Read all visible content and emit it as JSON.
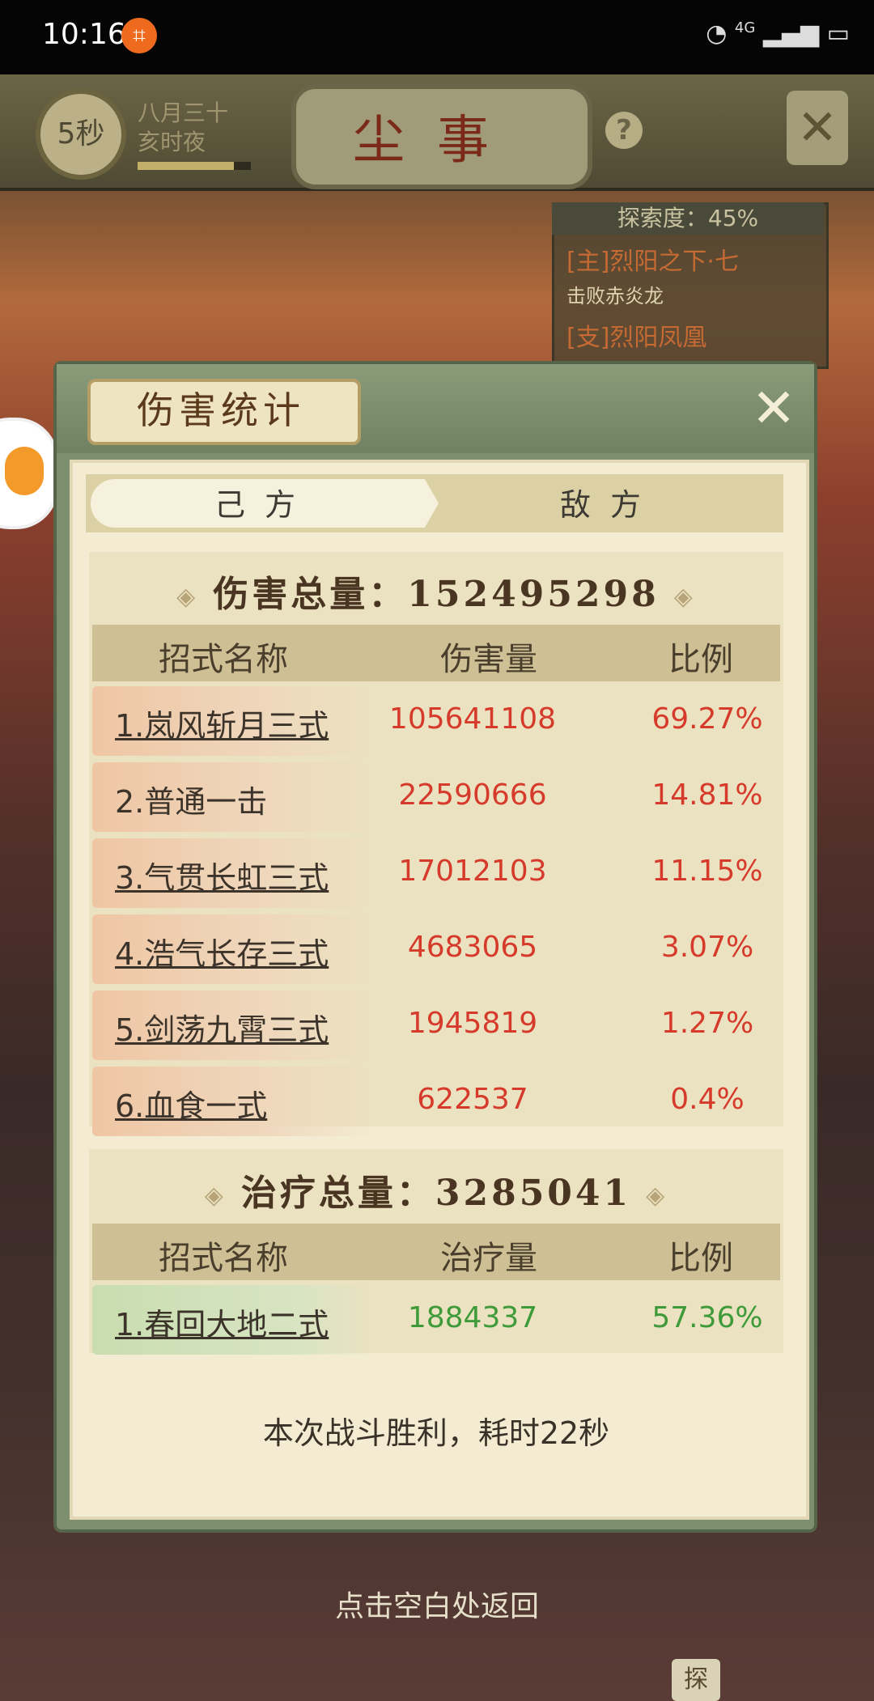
{
  "status_bar": {
    "time": "10:16",
    "network": "4G"
  },
  "game": {
    "timer": "5秒",
    "date_line1": "八月三十",
    "date_line2": "亥时夜",
    "title": "尘事",
    "help": "?",
    "quest": {
      "progress": "探索度：45%",
      "main": "[主]烈阳之下·七",
      "main_sub": "击败赤炎龙",
      "side": "[支]烈阳凤凰"
    }
  },
  "dialog": {
    "title": "伤害统计",
    "tabs": {
      "own": "己方",
      "enemy": "敌方"
    },
    "damage": {
      "total_label": "伤害总量：152495298",
      "headers": {
        "name": "招式名称",
        "value": "伤害量",
        "ratio": "比例"
      },
      "rows": [
        {
          "name": "1.岚风斩月三式",
          "value": "105641108",
          "ratio": "69.27%"
        },
        {
          "name": "2.普通一击",
          "value": "22590666",
          "ratio": "14.81%"
        },
        {
          "name": "3.气贯长虹三式",
          "value": "17012103",
          "ratio": "11.15%"
        },
        {
          "name": "4.浩气长存三式",
          "value": "4683065",
          "ratio": "3.07%"
        },
        {
          "name": "5.剑荡九霄三式",
          "value": "1945819",
          "ratio": "1.27%"
        },
        {
          "name": "6.血食一式",
          "value": "622537",
          "ratio": "0.4%"
        }
      ]
    },
    "healing": {
      "total_label": "治疗总量：3285041",
      "headers": {
        "name": "招式名称",
        "value": "治疗量",
        "ratio": "比例"
      },
      "rows": [
        {
          "name": "1.春回大地二式",
          "value": "1884337",
          "ratio": "57.36%"
        }
      ]
    },
    "result": "本次战斗胜利，耗时22秒"
  },
  "hint": "点击空白处返回",
  "explore_label": "探"
}
